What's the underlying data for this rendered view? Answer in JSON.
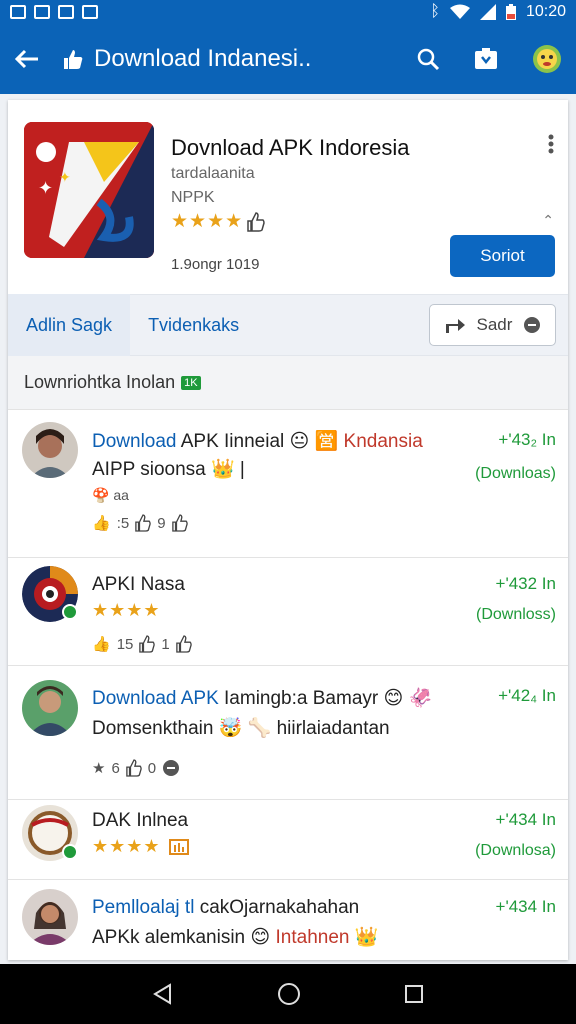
{
  "status_bar": {
    "time": "10:20"
  },
  "app_bar": {
    "title": "Download Indanesi..",
    "colors": {
      "primary": "#0b63b7",
      "accent": "#1f9a3a",
      "star": "#e9a21a"
    }
  },
  "app": {
    "name": "Dovnload APK Indoresia",
    "developer": "tardalaanita",
    "category": "NPPK",
    "stars": "★★★★",
    "size": "1.9ongr 1019",
    "install_label": "Soriot"
  },
  "tabs": [
    {
      "label": "Adlin Sagk"
    },
    {
      "label": "Tvidenkaks"
    }
  ],
  "share": {
    "label": "Sadr"
  },
  "section": {
    "title": "Lownriohtka Inolan",
    "badge": "1K"
  },
  "items": [
    {
      "title_blue": "Download",
      "title_rest": " APK Iinneial 😐 🈺 ",
      "title_red": "Kndansia",
      "subtitle": "AIPP sioonsa 👑 |",
      "small": "🍄 aa",
      "likes": ":5",
      "thumbs": "9",
      "count": "+'43₂ In",
      "downloads": "(Downloas)"
    },
    {
      "title_rest": "APKI Nasa",
      "stars": "★★★★",
      "likes": "15",
      "thumbs": "1",
      "count": "+'432 In",
      "downloads": "(Downloss)"
    },
    {
      "title_blue": "Download APK",
      "title_rest": " Iamingb:a Bamayr 😊 🦑",
      "subtitle": "Domsenkthain 🤯 🦴 hiirlaiadantan",
      "likes": "6",
      "thumbs": "0",
      "count": "+'42₄ In",
      "downloads": ""
    },
    {
      "title_rest": "DAK Inlnea",
      "stars": "★★★★",
      "count": "+'434 In",
      "downloads": "(Downlosa)"
    },
    {
      "title_blue": "Pemlloalaj tl",
      "title_rest": " cakOjarnakahahan",
      "subtitle_prefix": "APKk alemkanisin 😊 ",
      "subtitle_red": "Intahnen 👑",
      "count": "+'434 In"
    }
  ]
}
